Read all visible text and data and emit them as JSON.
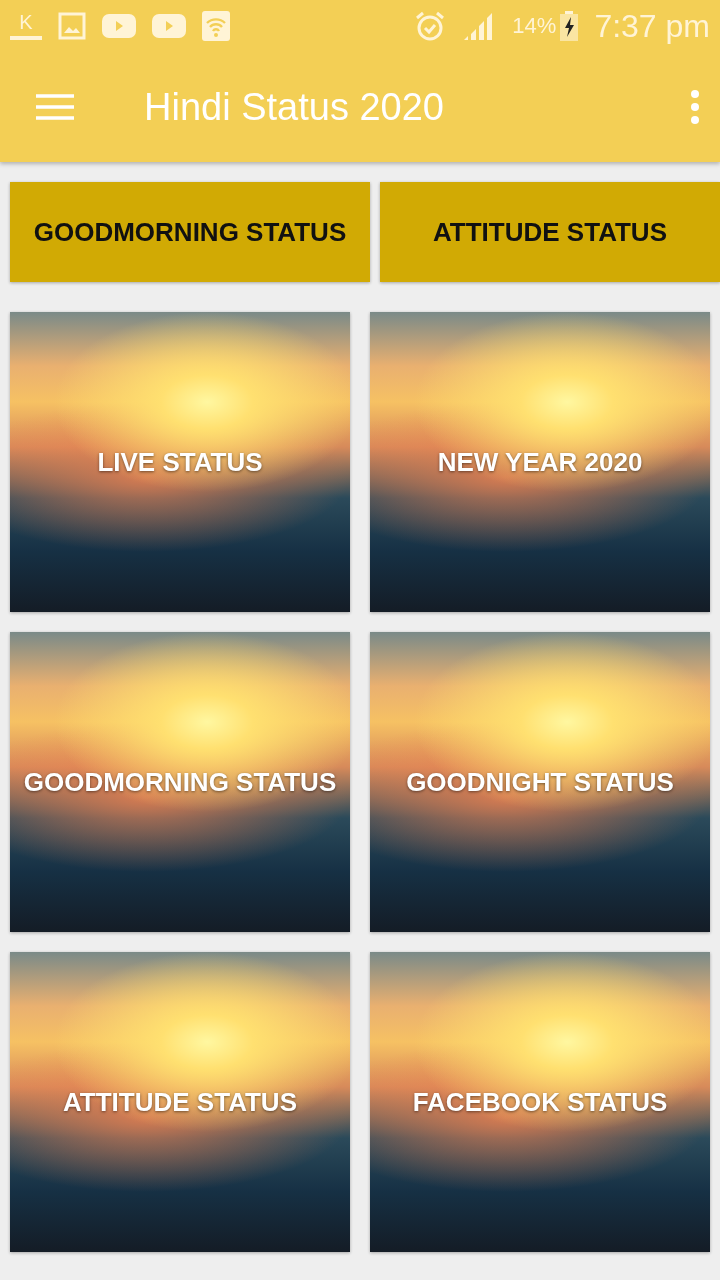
{
  "status_bar": {
    "notification_letter": "K",
    "battery": "14%",
    "time": "7:37 pm"
  },
  "app_bar": {
    "title": "Hindi Status 2020"
  },
  "top_buttons": [
    "GOODMORNING STATUS",
    "ATTITUDE STATUS"
  ],
  "tiles": [
    {
      "label": "LIVE STATUS"
    },
    {
      "label": "NEW YEAR 2020"
    },
    {
      "label": "GOODMORNING STATUS"
    },
    {
      "label": "GOODNIGHT STATUS"
    },
    {
      "label": "ATTITUDE STATUS"
    },
    {
      "label": "FACEBOOK STATUS"
    }
  ]
}
